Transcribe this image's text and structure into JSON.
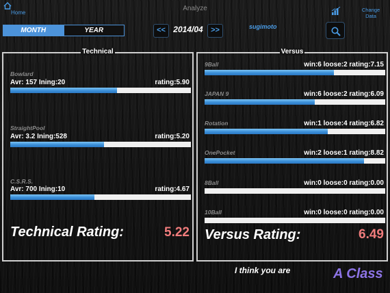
{
  "header": {
    "home_label": "Home",
    "title": "Analyze",
    "change_data_label": "Change Data"
  },
  "period_selector": {
    "month_label": "MONTH",
    "year_label": "YEAR",
    "selected": "MONTH",
    "prev_label": "<<",
    "next_label": ">>",
    "current": "2014/04"
  },
  "username": "sugimoto",
  "technical": {
    "title": "Technical",
    "items": [
      {
        "name": "Bowlard",
        "stats": "Avr: 157 Ining:20",
        "rating_text": "rating:5.90",
        "rating": 5.9
      },
      {
        "name": "StraightPool",
        "stats": "Avr: 3.2 Ining:528",
        "rating_text": "rating:5.20",
        "rating": 5.2
      },
      {
        "name": "C.S.R.S.",
        "stats": "Avr: 700 Ining:10",
        "rating_text": "rating:4.67",
        "rating": 4.67
      }
    ],
    "total_label": "Technical Rating:",
    "total_value": "5.22"
  },
  "versus": {
    "title": "Versus",
    "items": [
      {
        "name": "9Ball",
        "record": "win:6 loose:2 rating:7.15",
        "rating": 7.15
      },
      {
        "name": "JAPAN 9",
        "record": "win:6 loose:2 rating:6.09",
        "rating": 6.09
      },
      {
        "name": "Rotation",
        "record": "win:1 loose:4 rating:6.82",
        "rating": 6.82
      },
      {
        "name": "OnePocket",
        "record": "win:2 loose:1 rating:8.82",
        "rating": 8.82
      },
      {
        "name": "8Ball",
        "record": "win:0 loose:0 rating:0.00",
        "rating": 0.0
      },
      {
        "name": "10Ball",
        "record": "win:0 loose:0 rating:0.00",
        "rating": 0.0
      }
    ],
    "total_label": "Versus Rating:",
    "total_value": "6.49"
  },
  "verdict": {
    "prefix": "I think you are",
    "class_label": "A Class"
  },
  "colors": {
    "accent": "#4a9de8",
    "rating_value": "#f07c7c",
    "class_label": "#8d74e6"
  }
}
